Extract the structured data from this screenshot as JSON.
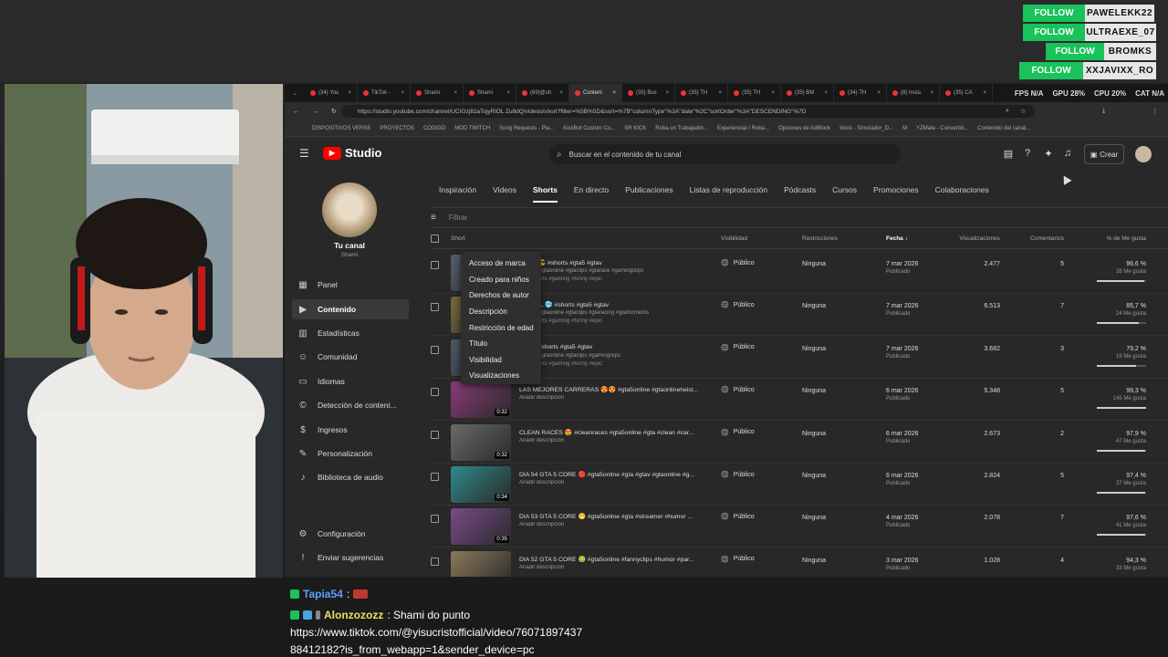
{
  "follows": [
    {
      "action": "FOLLOW",
      "name": "PAWELEKK22"
    },
    {
      "action": "FOLLOW",
      "name": "ULTRAEXE_07"
    },
    {
      "action": "FOLLOW",
      "name": "BROMKS"
    },
    {
      "action": "FOLLOW",
      "name": "XXJAVIXX_RO"
    }
  ],
  "browser": {
    "tabs": [
      "(34) You",
      "TikTok -",
      "Shami",
      "Shami",
      "(69)@sh",
      "Conteni",
      "(35) Bus",
      "(35) TH",
      "(35) TH",
      "(35) BM",
      "(34) TH",
      "(8) Insta",
      "(35) CA"
    ],
    "stats": [
      "FPS N/A",
      "GPU 28%",
      "CPU 20%",
      "CAT N/A"
    ],
    "url": "https://studio.youtube.com/channel/UCIGzj82aTojyRlOL Zu8dQ/videos/short?filter=%5B%5D&sort=%7B\"columnType\"%3A\"date\"%2C\"sortOrder\"%3A\"DESCENDING\"%7D",
    "bookmarks": [
      "DISPOSITIVOS VERSE",
      "PROYECTOS",
      "CODIGO",
      "MOD TWITCH",
      "Song Requests - Pla...",
      "KickBot Custom Co...",
      "SR KICK",
      "Roba un Trabajador...",
      "Experiencial / Roba...",
      "Opciones de AdBlock",
      "Inicio - Simulador_D...",
      "M",
      "YZMate - Convertid...",
      "Contenido del canal..."
    ]
  },
  "studio": {
    "logo": "Studio",
    "search_placeholder": "Buscar en el contenido de tu canal",
    "create_label": "Crear",
    "channel_label": "Tu canal",
    "channel_name": "Shami",
    "nav": [
      {
        "label": "Panel",
        "icon": "dashboard-icon"
      },
      {
        "label": "Contenido",
        "icon": "content-icon"
      },
      {
        "label": "Estadísticas",
        "icon": "analytics-icon"
      },
      {
        "label": "Comunidad",
        "icon": "community-icon"
      },
      {
        "label": "Idiomas",
        "icon": "subtitles-icon"
      },
      {
        "label": "Detección de conteni...",
        "icon": "copyright-icon"
      },
      {
        "label": "Ingresos",
        "icon": "earn-icon"
      },
      {
        "label": "Personalización",
        "icon": "customization-icon"
      },
      {
        "label": "Biblioteca de audio",
        "icon": "audio-library-icon"
      },
      {
        "label": "Configuración",
        "icon": "settings-icon"
      },
      {
        "label": "Enviar sugerencias",
        "icon": "feedback-icon"
      }
    ],
    "tabs": [
      "Inspiración",
      "Videos",
      "Shorts",
      "En directo",
      "Publicaciones",
      "Listas de reproducción",
      "Pódcasts",
      "Cursos",
      "Promociones",
      "Colaboraciones"
    ],
    "active_tab": "Shorts",
    "filter_placeholder": "Filtrar",
    "columns": {
      "short": "Short",
      "visibility": "Visibilidad",
      "restrictions": "Restricciones",
      "date": "Fecha",
      "views": "Visualizaciones",
      "comments": "Comentarios",
      "likes": "% de Me gusta"
    },
    "dropdown": [
      "Acceso de marca",
      "Creado para niños",
      "Derechos de autor",
      "Descripción",
      "Restricción de edad",
      "Título",
      "Visibilidad",
      "Visualizaciones"
    ],
    "rows": [
      {
        "title": "TOTO 😎 #shorts #gta5 #gtav",
        "sub": "#shorts #gtaonline #gtaclips #gtarace #gamingclips",
        "desc": "#viralshorts #gaming #funny #epic",
        "duration": "",
        "visibility": "Público",
        "restriction": "Ninguna",
        "date": "7 mar 2026",
        "status": "Publicado",
        "views": "2.477",
        "comments": "5",
        "like_pct": "96,6 %",
        "likes": "28 Me gusta",
        "like_frac": 0.966
      },
      {
        "title": "O FÁCIL 🥶 #shorts #gta5 #gtav",
        "sub": "#shorts #gtaonline #gtaclips #gtaracing #gtamoments",
        "desc": "#viralshorts #gaming #funny #epic",
        "duration": "",
        "visibility": "Público",
        "restriction": "Ninguna",
        "date": "7 mar 2026",
        "status": "Publicado",
        "views": "6.513",
        "comments": "7",
        "like_pct": "85,7 %",
        "likes": "24 Me gusta",
        "like_frac": 0.857
      },
      {
        "title": "TOTO #shorts #gta5 #gtav",
        "sub": "#shorts #gtaonline #gtaclips #gamingclips",
        "desc": "#viralshorts #gaming #funny #epic",
        "duration": "",
        "visibility": "Público",
        "restriction": "Ninguna",
        "date": "7 mar 2026",
        "status": "Publicado",
        "views": "3.682",
        "comments": "3",
        "like_pct": "79,2 %",
        "likes": "19 Me gusta",
        "like_frac": 0.792
      },
      {
        "title": "LAS MEJORES CARRERAS 😍😍 #gta5online #gtaonlineheist...",
        "sub": "Añadir descripción",
        "desc": "",
        "duration": "0:32",
        "visibility": "Público",
        "restriction": "Ninguna",
        "date": "6 mar 2026",
        "status": "Publicado",
        "views": "5.348",
        "comments": "5",
        "like_pct": "99,3 %",
        "likes": "145 Me gusta",
        "like_frac": 0.993
      },
      {
        "title": "CLEAN RACES 😍 #cleanraces #gta5online #gta #clean #car...",
        "sub": "Añadir descripción",
        "desc": "",
        "duration": "0:32",
        "visibility": "Público",
        "restriction": "Ninguna",
        "date": "6 mar 2026",
        "status": "Publicado",
        "views": "2.673",
        "comments": "2",
        "like_pct": "97,9 %",
        "likes": "47 Me gusta",
        "like_frac": 0.979
      },
      {
        "title": "DIA 54 GTA 5 CORE 🔴 #gta5online #gta #gtav #gtaonline #g...",
        "sub": "Añadir descripción",
        "desc": "",
        "duration": "0:34",
        "visibility": "Público",
        "restriction": "Ninguna",
        "date": "6 mar 2026",
        "status": "Publicado",
        "views": "2.824",
        "comments": "5",
        "like_pct": "97,4 %",
        "likes": "37 Me gusta",
        "like_frac": 0.974
      },
      {
        "title": "DIA 53 GTA 5 CORE 😁 #gta5online #gta #streamer #humor ...",
        "sub": "Añadir descripción",
        "desc": "",
        "duration": "0:35",
        "visibility": "Público",
        "restriction": "Ninguna",
        "date": "4 mar 2026",
        "status": "Publicado",
        "views": "2.078",
        "comments": "7",
        "like_pct": "97,6 %",
        "likes": "41 Me gusta",
        "like_frac": 0.976
      },
      {
        "title": "DIA 52 GTA 5 CORE 🤢 #gta5online #fannyclips #humor #par...",
        "sub": "Añadir descripción",
        "desc": "",
        "duration": "",
        "visibility": "Público",
        "restriction": "Ninguna",
        "date": "3 mar 2026",
        "status": "Publicado",
        "views": "1.028",
        "comments": "4",
        "like_pct": "94,3 %",
        "likes": "33 Me gusta",
        "like_frac": 0.943
      }
    ]
  },
  "chat": [
    {
      "user": "Tapia54",
      "text": "",
      "color": "#5aa0ff"
    },
    {
      "user": "Alonzozozz",
      "text": ": Shami do punto",
      "color": "#f0e060"
    },
    {
      "user": "",
      "text": "https://www.tiktok.com/@yisucristofficial/video/76071897437",
      "color": "#fff"
    },
    {
      "user": "",
      "text": "88412182?is_from_webapp=1&sender_device=pc",
      "color": "#fff"
    }
  ]
}
